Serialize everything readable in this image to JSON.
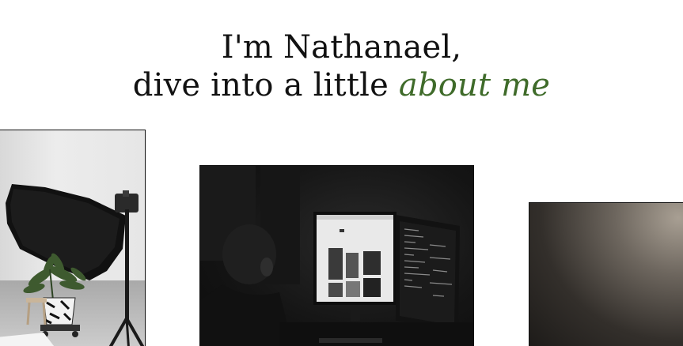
{
  "hero": {
    "line1": "I'm Nathanael,",
    "line2_prefix": "dive into a little ",
    "line2_accent": "about me"
  },
  "colors": {
    "accent": "#3f6b2a",
    "text": "#111111",
    "background": "#ffffff"
  }
}
